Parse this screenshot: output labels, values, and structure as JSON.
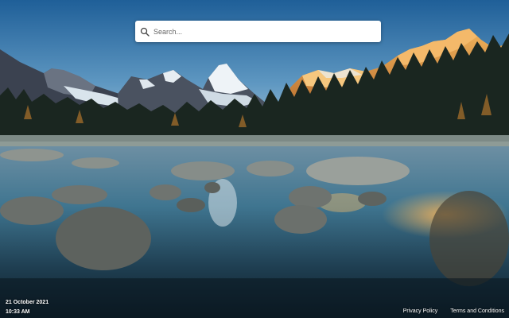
{
  "search": {
    "placeholder": "Search...",
    "icon": "search-icon"
  },
  "datetime": {
    "date": "21 October 2021",
    "time": "10:33 AM"
  },
  "footer": {
    "privacy_label": "Privacy Policy",
    "terms_label": "Terms and Conditions"
  },
  "colors": {
    "sky_top": "#2f6fa6",
    "sky_bottom": "#a9c8dc",
    "sunlit_peak": "#e8a248",
    "water": "#3a6f8a"
  }
}
